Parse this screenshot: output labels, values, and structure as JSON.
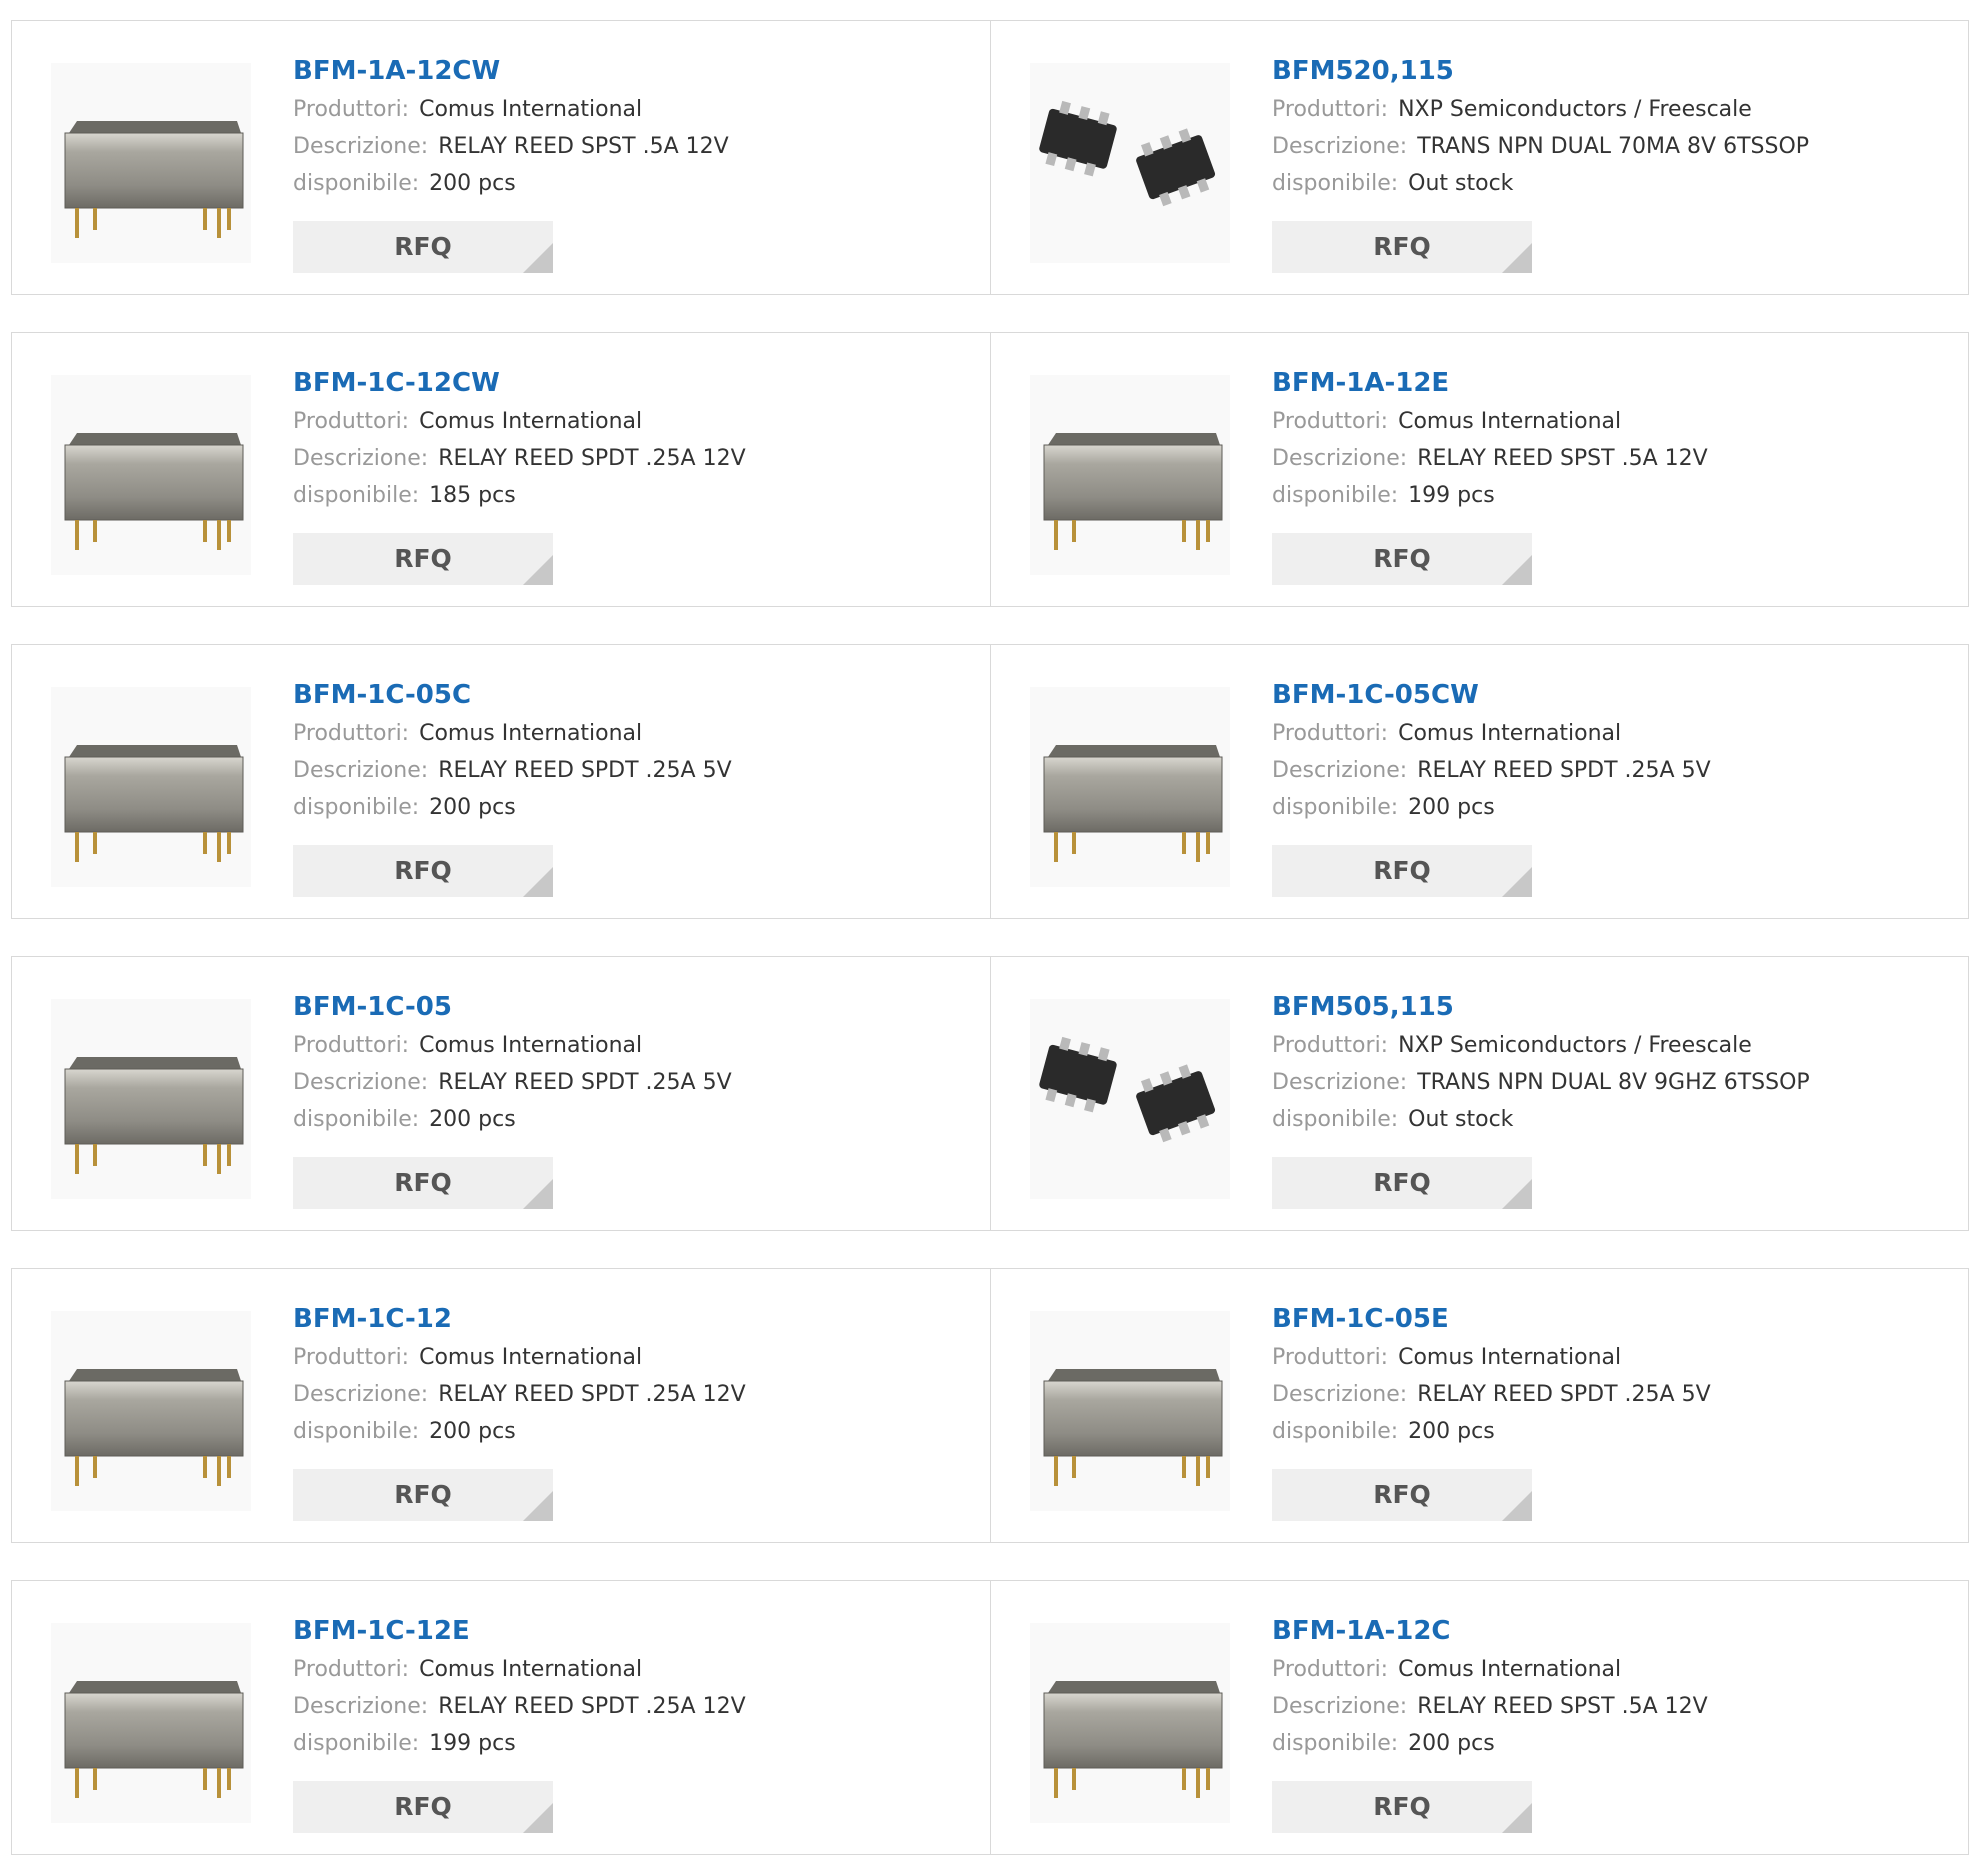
{
  "labels": {
    "manufacturer": "Produttori:",
    "description": "Descrizione:",
    "available": "disponibile:"
  },
  "rfq_label": "RFQ",
  "colors": {
    "title": "#1a6bb5",
    "label": "#999999",
    "value": "#333333",
    "button_bg": "#efefef"
  },
  "products": [
    {
      "title": "BFM-1A-12CW",
      "manufacturer": "Comus International",
      "description": "RELAY REED SPST .5A 12V",
      "available": "200 pcs",
      "image": "reed-relay-image"
    },
    {
      "title": "BFM520,115",
      "manufacturer": "NXP Semiconductors / Freescale",
      "description": "TRANS NPN DUAL 70MA 8V 6TSSOP",
      "available": "Out stock",
      "image": "tssop-chip-image"
    },
    {
      "title": "BFM-1C-12CW",
      "manufacturer": "Comus International",
      "description": "RELAY REED SPDT .25A 12V",
      "available": "185 pcs",
      "image": "reed-relay-image"
    },
    {
      "title": "BFM-1A-12E",
      "manufacturer": "Comus International",
      "description": "RELAY REED SPST .5A 12V",
      "available": "199 pcs",
      "image": "reed-relay-image"
    },
    {
      "title": "BFM-1C-05C",
      "manufacturer": "Comus International",
      "description": "RELAY REED SPDT .25A 5V",
      "available": "200 pcs",
      "image": "reed-relay-image"
    },
    {
      "title": "BFM-1C-05CW",
      "manufacturer": "Comus International",
      "description": "RELAY REED SPDT .25A 5V",
      "available": "200 pcs",
      "image": "reed-relay-image"
    },
    {
      "title": "BFM-1C-05",
      "manufacturer": "Comus International",
      "description": "RELAY REED SPDT .25A 5V",
      "available": "200 pcs",
      "image": "reed-relay-image"
    },
    {
      "title": "BFM505,115",
      "manufacturer": "NXP Semiconductors / Freescale",
      "description": "TRANS NPN DUAL 8V 9GHZ 6TSSOP",
      "available": "Out stock",
      "image": "tssop-chip-image"
    },
    {
      "title": "BFM-1C-12",
      "manufacturer": "Comus International",
      "description": "RELAY REED SPDT .25A 12V",
      "available": "200 pcs",
      "image": "reed-relay-image"
    },
    {
      "title": "BFM-1C-05E",
      "manufacturer": "Comus International",
      "description": "RELAY REED SPDT .25A 5V",
      "available": "200 pcs",
      "image": "reed-relay-image"
    },
    {
      "title": "BFM-1C-12E",
      "manufacturer": "Comus International",
      "description": "RELAY REED SPDT .25A 12V",
      "available": "199 pcs",
      "image": "reed-relay-image"
    },
    {
      "title": "BFM-1A-12C",
      "manufacturer": "Comus International",
      "description": "RELAY REED SPST .5A 12V",
      "available": "200 pcs",
      "image": "reed-relay-image"
    }
  ]
}
